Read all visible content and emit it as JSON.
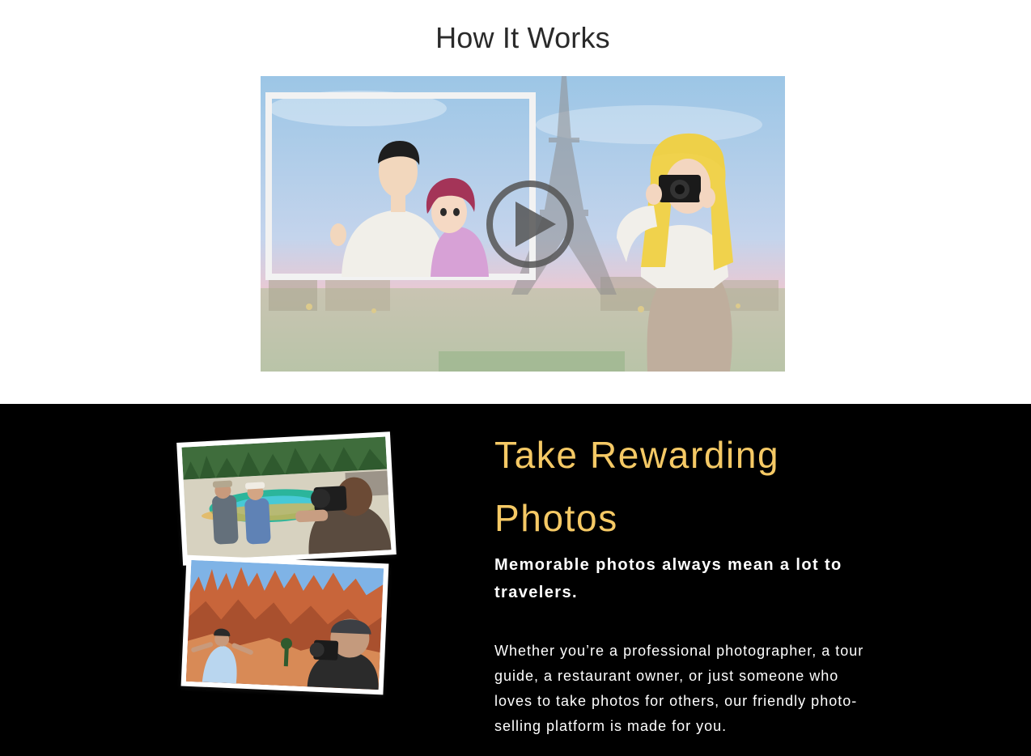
{
  "how_it_works": {
    "title": "How It Works",
    "video": {
      "play_icon": "play-circle-icon",
      "scene": "animated-video-thumbnail"
    }
  },
  "rewarding": {
    "headline": "Take Rewarding Photos",
    "subheadline": "Memorable photos always mean a lot to travelers.",
    "body": "Whether you’re a professional photographer, a tour guide, a restaurant owner, or just someone who loves to take photos for others, our friendly photo-selling platform is made for you."
  },
  "colors": {
    "accent_gold": "#f5c965",
    "dark_bg": "#000000",
    "page_bg": "#ffffff"
  }
}
